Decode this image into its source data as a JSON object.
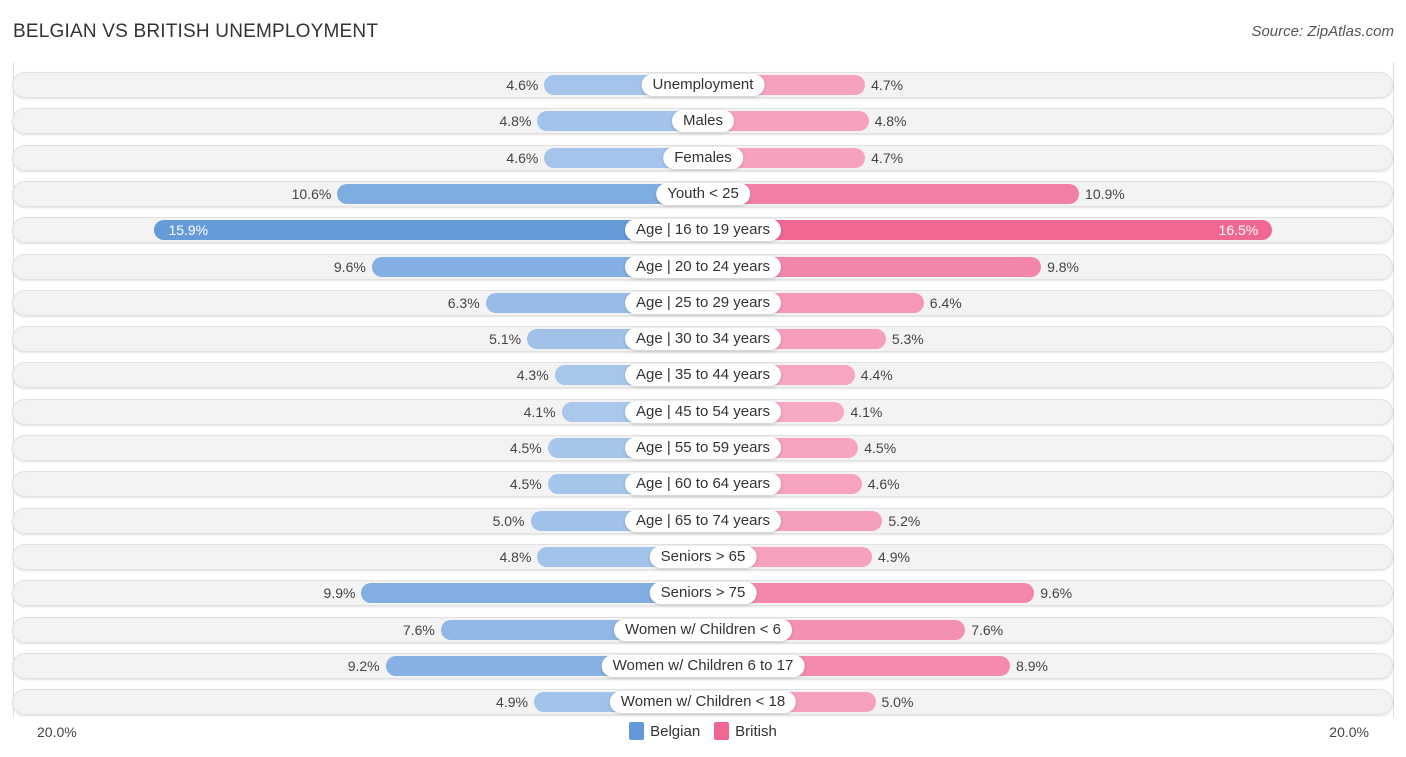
{
  "title": "BELGIAN VS BRITISH UNEMPLOYMENT",
  "source": "Source: ZipAtlas.com",
  "colors": {
    "belgian_strong": "#6399d9",
    "belgian_light": "#a9c8ec",
    "british_strong": "#f06892",
    "british_light": "#f7a8c2"
  },
  "chart_data": {
    "type": "bar",
    "orientation": "horizontal-diverging",
    "title": "BELGIAN VS BRITISH UNEMPLOYMENT",
    "xlim": [
      -20,
      20
    ],
    "axis_labels": {
      "left": "20.0%",
      "right": "20.0%"
    },
    "legend": {
      "placement": "bottom-center",
      "entries": [
        "Belgian",
        "British"
      ]
    },
    "categories": [
      "Unemployment",
      "Males",
      "Females",
      "Youth < 25",
      "Age | 16 to 19 years",
      "Age | 20 to 24 years",
      "Age | 25 to 29 years",
      "Age | 30 to 34 years",
      "Age | 35 to 44 years",
      "Age | 45 to 54 years",
      "Age | 55 to 59 years",
      "Age | 60 to 64 years",
      "Age | 65 to 74 years",
      "Seniors > 65",
      "Seniors > 75",
      "Women w/ Children < 6",
      "Women w/ Children 6 to 17",
      "Women w/ Children < 18"
    ],
    "series": [
      {
        "name": "Belgian",
        "side": "left",
        "values": [
          4.6,
          4.8,
          4.6,
          10.6,
          15.9,
          9.6,
          6.3,
          5.1,
          4.3,
          4.1,
          4.5,
          4.5,
          5.0,
          4.8,
          9.9,
          7.6,
          9.2,
          4.9
        ],
        "labels": [
          "4.6%",
          "4.8%",
          "4.6%",
          "10.6%",
          "15.9%",
          "9.6%",
          "6.3%",
          "5.1%",
          "4.3%",
          "4.1%",
          "4.5%",
          "4.5%",
          "5.0%",
          "4.8%",
          "9.9%",
          "7.6%",
          "9.2%",
          "4.9%"
        ]
      },
      {
        "name": "British",
        "side": "right",
        "values": [
          4.7,
          4.8,
          4.7,
          10.9,
          16.5,
          9.8,
          6.4,
          5.3,
          4.4,
          4.1,
          4.5,
          4.6,
          5.2,
          4.9,
          9.6,
          7.6,
          8.9,
          5.0
        ],
        "labels": [
          "4.7%",
          "4.8%",
          "4.7%",
          "10.9%",
          "16.5%",
          "9.8%",
          "6.4%",
          "5.3%",
          "4.4%",
          "4.1%",
          "4.5%",
          "4.6%",
          "5.2%",
          "4.9%",
          "9.6%",
          "7.6%",
          "8.9%",
          "5.0%"
        ]
      }
    ]
  }
}
